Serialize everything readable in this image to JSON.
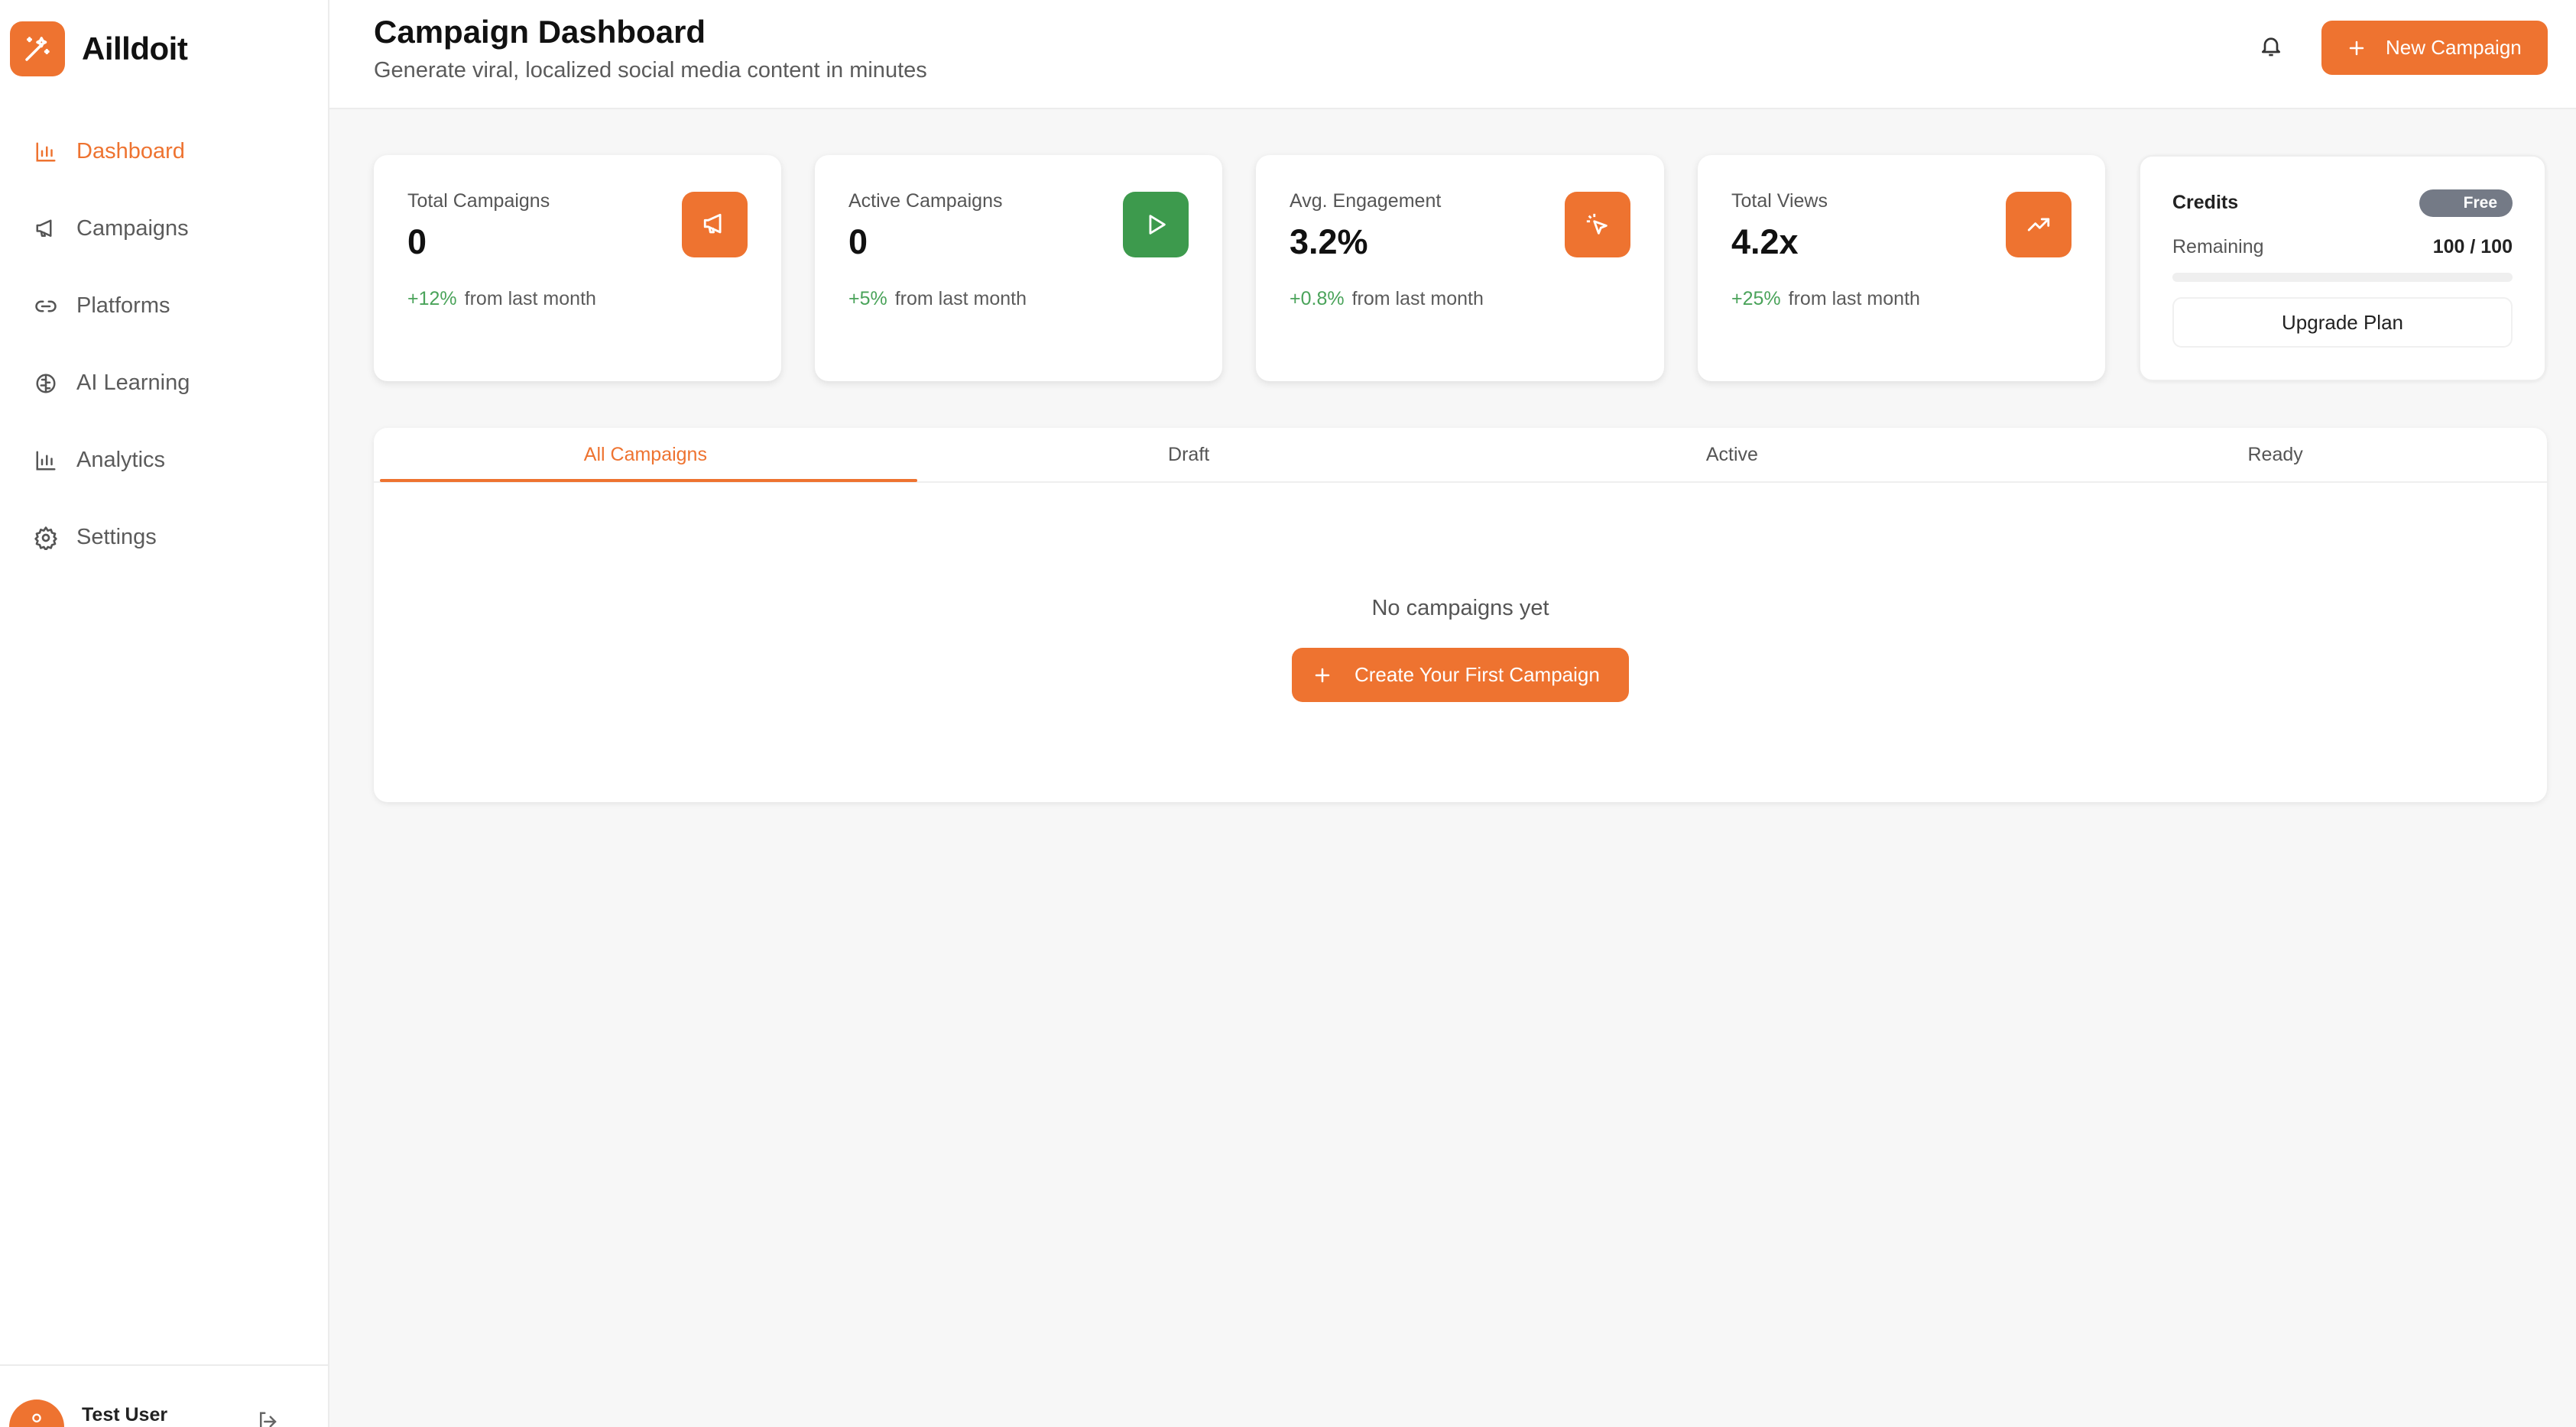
{
  "app": {
    "name": "Ailldoit",
    "accent": "#ee7330",
    "success": "#4aa35a"
  },
  "sidebar": {
    "items": [
      {
        "label": "Dashboard",
        "icon": "bar-chart-icon",
        "active": true
      },
      {
        "label": "Campaigns",
        "icon": "megaphone-icon",
        "active": false
      },
      {
        "label": "Platforms",
        "icon": "link-icon",
        "active": false
      },
      {
        "label": "AI Learning",
        "icon": "brain-icon",
        "active": false
      },
      {
        "label": "Analytics",
        "icon": "bar-chart-icon",
        "active": false
      },
      {
        "label": "Settings",
        "icon": "gear-icon",
        "active": false
      }
    ],
    "user": {
      "name": "Test User"
    }
  },
  "header": {
    "title": "Campaign Dashboard",
    "subtitle": "Generate viral, localized social media content in minutes",
    "new_campaign_label": "New Campaign"
  },
  "stats": [
    {
      "label": "Total Campaigns",
      "value": "0",
      "change": "+12%",
      "change_suffix": "from last month",
      "icon": "megaphone-icon"
    },
    {
      "label": "Active Campaigns",
      "value": "0",
      "change": "+5%",
      "change_suffix": "from last month",
      "icon": "play-icon"
    },
    {
      "label": "Avg. Engagement",
      "value": "3.2%",
      "change": "+0.8%",
      "change_suffix": "from last month",
      "icon": "cursor-click-icon"
    },
    {
      "label": "Total Views",
      "value": "4.2x",
      "change": "+25%",
      "change_suffix": "from last month",
      "icon": "trending-up-icon"
    }
  ],
  "credits": {
    "title": "Credits",
    "plan_badge": "Free",
    "remaining_label": "Remaining",
    "remaining_value": "100 / 100",
    "used_fraction": 0,
    "upgrade_label": "Upgrade Plan"
  },
  "campaigns": {
    "tabs": [
      "All Campaigns",
      "Draft",
      "Active",
      "Ready"
    ],
    "active_tab": "All Campaigns",
    "empty_text": "No campaigns yet",
    "create_first_label": "Create Your First Campaign"
  }
}
